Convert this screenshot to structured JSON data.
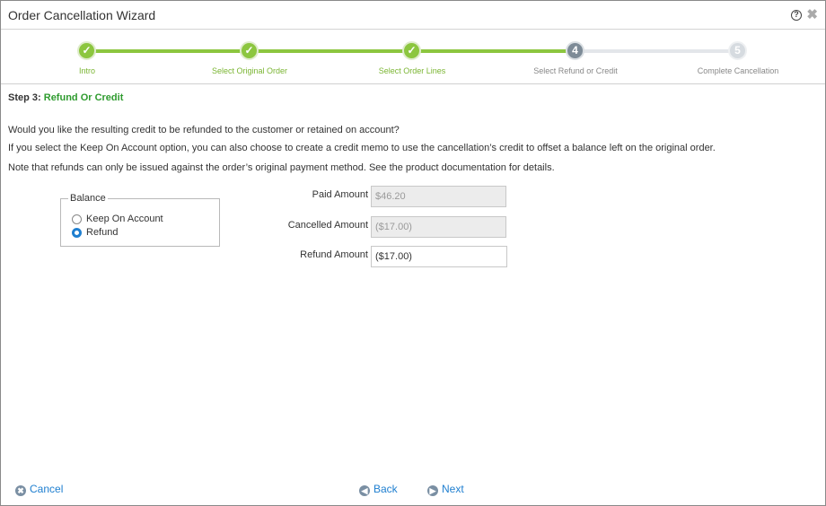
{
  "window": {
    "title": "Order Cancellation Wizard",
    "help_icon": "question-circle-icon",
    "help_glyph": "?",
    "close_icon": "close-icon",
    "close_glyph": "✖"
  },
  "stepper": {
    "steps": [
      {
        "label": "Intro",
        "state": "done",
        "glyph": "✓"
      },
      {
        "label": "Select Original Order",
        "state": "done",
        "glyph": "✓"
      },
      {
        "label": "Select Order Lines",
        "state": "done",
        "glyph": "✓"
      },
      {
        "label": "Select Refund or Credit",
        "state": "current",
        "glyph": "4"
      },
      {
        "label": "Complete Cancellation",
        "state": "future",
        "glyph": "5"
      }
    ],
    "colors": {
      "done": "#8cc63f",
      "current": "#7d8b97",
      "future": "#d6dbe0"
    }
  },
  "heading": {
    "prefix": "Step 3:",
    "title": "Refund Or Credit"
  },
  "info": {
    "line1": "Would you like the resulting credit to be refunded to the customer or retained on account?",
    "line2": "If you select the Keep On Account option, you can also choose to create a credit memo to use the cancellation’s credit to offset a balance left on the original order.",
    "line3": "Note that refunds can only be issued against the order’s original payment method. See the product documentation for details."
  },
  "balance": {
    "legend": "Balance",
    "options": [
      {
        "label": "Keep On Account",
        "selected": false
      },
      {
        "label": "Refund",
        "selected": true
      }
    ]
  },
  "fields": {
    "paid_label": "Paid Amount",
    "paid_value": "$46.20",
    "cancelled_label": "Cancelled Amount",
    "cancelled_value": "($17.00)",
    "refund_label": "Refund Amount",
    "refund_value": "($17.00)"
  },
  "footer": {
    "cancel_label": "Cancel",
    "cancel_icon": "cancel-circle-icon",
    "cancel_glyph": "✖",
    "back_label": "Back",
    "back_icon": "back-arrow-icon",
    "back_glyph": "◀",
    "next_label": "Next",
    "next_icon": "next-arrow-icon",
    "next_glyph": "▶",
    "link_color": "#1f7fd0"
  }
}
